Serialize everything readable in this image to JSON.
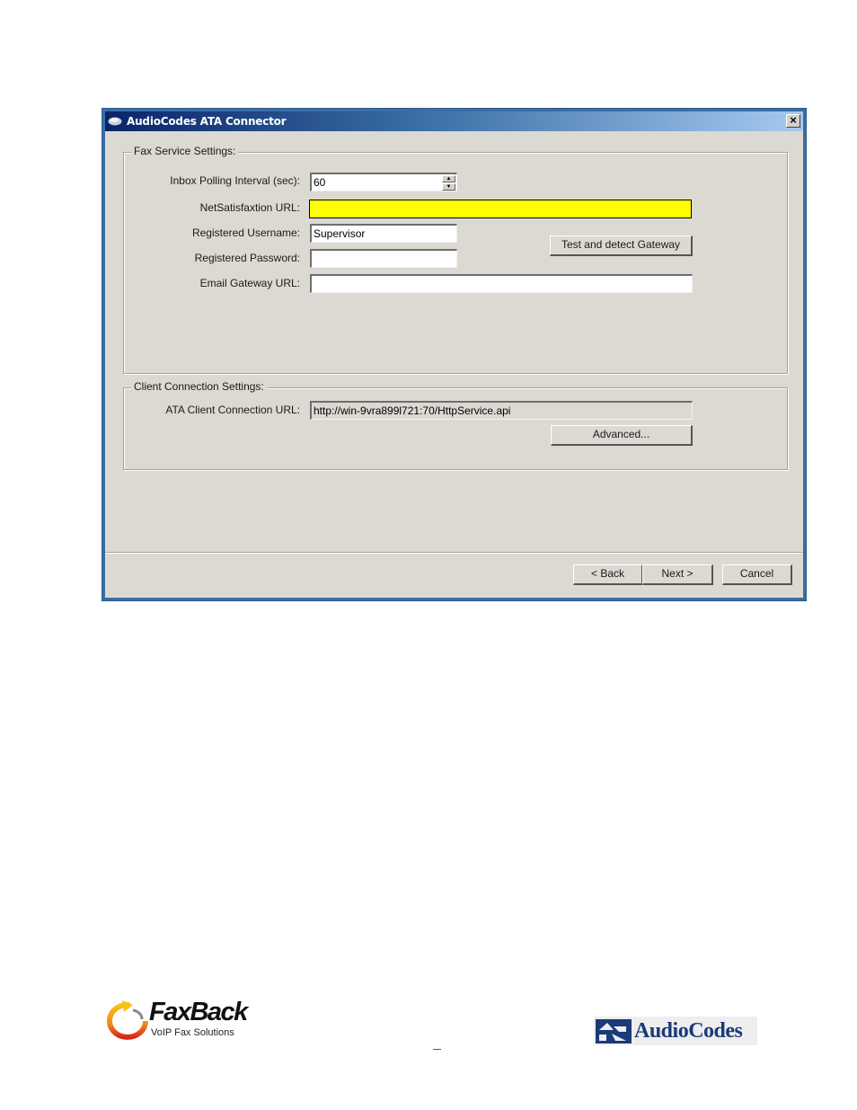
{
  "window": {
    "title": "AudioCodes ATA Connector",
    "close_label": "×"
  },
  "fax_service": {
    "group_title": "Fax Service Settings:",
    "inbox_polling": {
      "label": "Inbox Polling Interval (sec):",
      "value": "60"
    },
    "netsatisfaxtion_url": {
      "label": "NetSatisfaxtion URL:",
      "value": "",
      "highlight_color": "#ffff00"
    },
    "registered_username": {
      "label": "Registered Username:",
      "value": "Supervisor"
    },
    "registered_password": {
      "label": "Registered Password:",
      "value": ""
    },
    "email_gateway_url": {
      "label": "Email Gateway URL:",
      "value": ""
    },
    "test_button_label": "Test and detect Gateway"
  },
  "client_connection": {
    "group_title": "Client Connection Settings:",
    "ata_client_url": {
      "label": "ATA Client Connection URL:",
      "value": "http://win-9vra899l721:70/HttpService.api"
    },
    "advanced_button_label": "Advanced..."
  },
  "footer_buttons": {
    "back": "< Back",
    "next": "Next >",
    "cancel": "Cancel"
  },
  "page_footer": {
    "faxback_name": "FaxBack",
    "faxback_tagline": "VoIP Fax Solutions",
    "audiocodes_name": "AudioCodes",
    "page_number": "–"
  }
}
